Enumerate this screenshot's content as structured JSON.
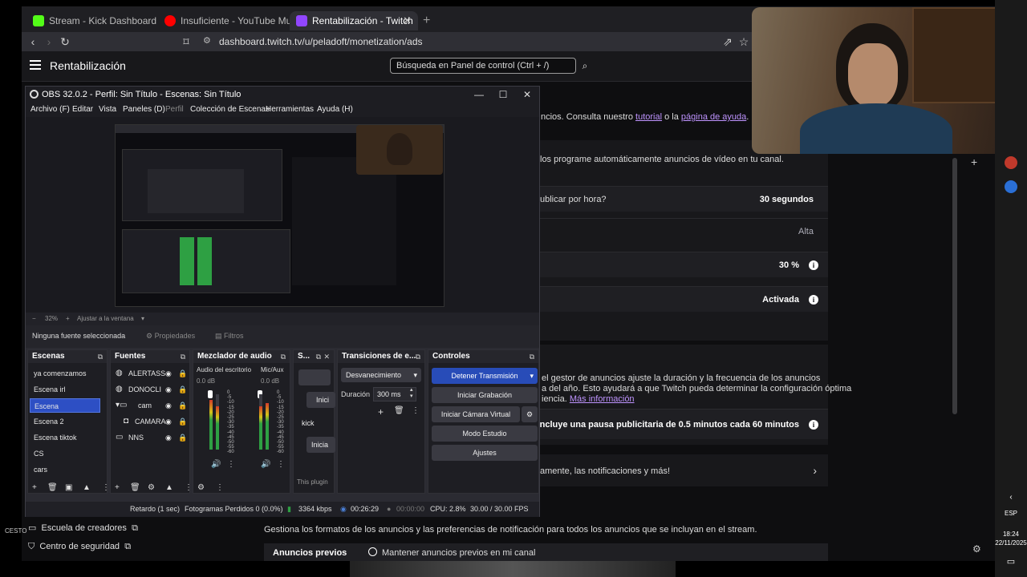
{
  "browser": {
    "tabs": [
      {
        "title": "Stream - Kick Dashboard",
        "color": "#53fc18"
      },
      {
        "title": "Insuficiente - YouTube Music",
        "color": "#ff0000"
      },
      {
        "title": "Rentabilización - Twitch",
        "color": "#9146ff"
      }
    ],
    "url": "dashboard.twitch.tv/u/peladoft/monetization/ads"
  },
  "twitch": {
    "page_title": "Rentabilización",
    "search_placeholder": "Búsqueda en Panel de control (Ctrl + /)",
    "intro_prefix": "ncios. Consulta nuestro",
    "intro_link1": "tutorial",
    "intro_mid": "o la",
    "intro_link2": "página de ayuda",
    "intro_suffix": ".",
    "auto_ads": "los programe automáticamente anuncios de vídeo en tu canal.",
    "rows": [
      {
        "label": "ublicar por hora?",
        "value": "30 segundos"
      },
      {
        "label": "",
        "value": "Alta"
      },
      {
        "label": "",
        "value": "30 %"
      },
      {
        "label": "",
        "value": "Activada"
      }
    ],
    "manager_text1": "el gestor de anuncios ajuste la duración y la frecuencia de los anuncios",
    "manager_text2": "a del año. Esto ayudará a que Twitch pueda determinar la configuración óptima",
    "manager_text3": "iencia.",
    "manager_link": "Más información",
    "manager_value": "Incluye una pausa publicitaria de 0.5 minutos cada 60 minutos",
    "notif_text": "amente, las notificaciones y más!",
    "formats_desc": "Gestiona los formatos de los anuncios y las preferencias de notificación para todos los anuncios que se incluyan en el stream.",
    "preroll_title": "Anuncios previos",
    "preroll_option": "Mantener anuncios previos en mi canal",
    "nav": [
      {
        "label": "Escuela de creadores"
      },
      {
        "label": "Centro de seguridad"
      }
    ]
  },
  "obs": {
    "title": "OBS 32.0.2 - Perfil: Sin Título - Escenas: Sin Título",
    "menu": [
      "Archivo (F)",
      "Editar",
      "Vista",
      "Paneles (D)",
      "Perfil",
      "Colección de Escenas",
      "Herramientas",
      "Ayuda (H)"
    ],
    "zoom": "32%",
    "fit": "Ajustar a la ventana",
    "no_source": "Ninguna fuente seleccionada",
    "properties": "Propiedades",
    "filters": "Filtros",
    "panels": {
      "scenes": "Escenas",
      "sources": "Fuentes",
      "mixer": "Mezclador de audio",
      "s": "S...",
      "transitions": "Transiciones de e...",
      "controls": "Controles"
    },
    "scenes": [
      "ya comenzamos",
      "Escena irl",
      "Escena",
      "Escena 2",
      "Escena tiktok",
      "CS",
      "cars"
    ],
    "selected_scene": "Escena",
    "sources": [
      {
        "name": "ALERTASS",
        "icon": "globe"
      },
      {
        "name": "DONOCLI",
        "icon": "globe"
      },
      {
        "name": "cam",
        "icon": "folder"
      },
      {
        "name": "CAMARA",
        "icon": "camera"
      },
      {
        "name": "NNS",
        "icon": "display"
      }
    ],
    "mixer": [
      {
        "name": "Audio del escritorio",
        "db": "0.0 dB"
      },
      {
        "name": "Mic/Aux",
        "db": "0.0 dB"
      }
    ],
    "mixer_scale": [
      "0",
      "-5",
      "-10",
      "-15",
      "-20",
      "-25",
      "-30",
      "-35",
      "-40",
      "-45",
      "-50",
      "-55",
      "-60"
    ],
    "stingers": [
      "Inici",
      "kick",
      "Inicia",
      "This plugin"
    ],
    "transition": "Desvanecimiento",
    "duration_label": "Duración",
    "duration_value": "300 ms",
    "controls": [
      "Detener Transmisión",
      "Iniciar Grabación",
      "Iniciar Cámara Virtual",
      "Modo Estudio",
      "Ajustes"
    ],
    "status": {
      "delay": "Retardo (1 sec)",
      "dropped": "Fotogramas Perdidos 0 (0.0%)",
      "bitrate": "3364 kbps",
      "live_time": "00:26:29",
      "rec_time": "00:00:00",
      "cpu": "CPU: 2.8%",
      "fps": "30.00 / 30.00 FPS"
    }
  },
  "taskbar": {
    "lang": "ESP",
    "time": "18:24",
    "date": "22/11/2025"
  },
  "desktop": {
    "label_left": "CESTO"
  }
}
